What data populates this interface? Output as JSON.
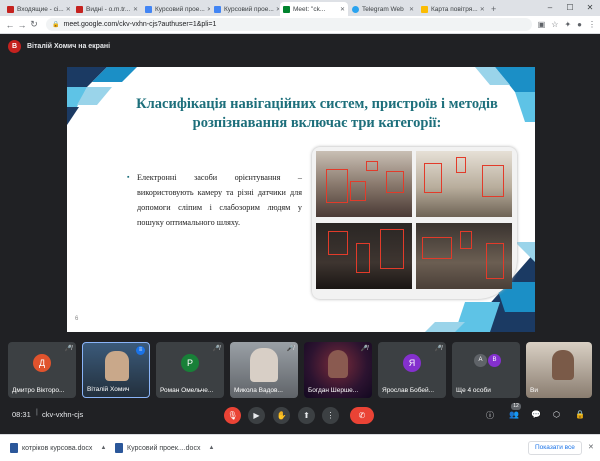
{
  "browser": {
    "tabs": [
      {
        "label": "Входящие - ci...",
        "color": "#c5221f",
        "active": false
      },
      {
        "label": "Видні - o.m.tr...",
        "color": "#c5221f",
        "active": false
      },
      {
        "label": "Курсовий прое...",
        "color": "#4285f4",
        "active": false
      },
      {
        "label": "Курсовий прое...",
        "color": "#4285f4",
        "active": false
      },
      {
        "label": "Meet: \"ck...",
        "color": "#00832d",
        "active": true
      },
      {
        "label": "Telegram Web",
        "color": "#2aa3ef",
        "active": false
      },
      {
        "label": "Карта повітря...",
        "color": "#fbbc04",
        "active": false
      }
    ],
    "url": "meet.google.com/ckv-vxhn-cjs?authuser=1&pli=1",
    "new_tab": "+"
  },
  "banner": {
    "avatar_letter": "В",
    "text": "Віталій Хомич на екрані"
  },
  "slide": {
    "title": "Класифікація навігаційних систем, пристроїв і методів розпізнавання включає три категорії:",
    "bullet": "Електронні засоби орієнтування – використовують камеру та різні датчики для допомоги сліпим і слабозорим людям у пошуку оптимального шляху.",
    "page_number": "6"
  },
  "participants": [
    {
      "name": "Дмитро Вікторо...",
      "letter": "Д",
      "color": "#e0532d"
    },
    {
      "name": "Віталій Хомич",
      "letter": "",
      "color": ""
    },
    {
      "name": "Роман Омельче...",
      "letter": "Р",
      "color": "#188038"
    },
    {
      "name": "Микола Вадов...",
      "letter": "",
      "color": ""
    },
    {
      "name": "Богдан Шерше...",
      "letter": "",
      "color": ""
    },
    {
      "name": "Ярослав Бобей...",
      "letter": "Я",
      "color": "#8430ce"
    },
    {
      "name": "Ще 4 особи",
      "letter": "",
      "color": ""
    },
    {
      "name": "Ви",
      "letter": "",
      "color": ""
    }
  ],
  "more_avatars": [
    "А",
    "В"
  ],
  "controls": {
    "time": "08:31",
    "separator": "|",
    "meeting_code": "ckv-vxhn-cjs",
    "participants_count": "12"
  },
  "downloads": [
    {
      "name": "котріков курсова.docx"
    },
    {
      "name": "Курсовий проек....docx"
    }
  ],
  "show_all": "Показати все"
}
